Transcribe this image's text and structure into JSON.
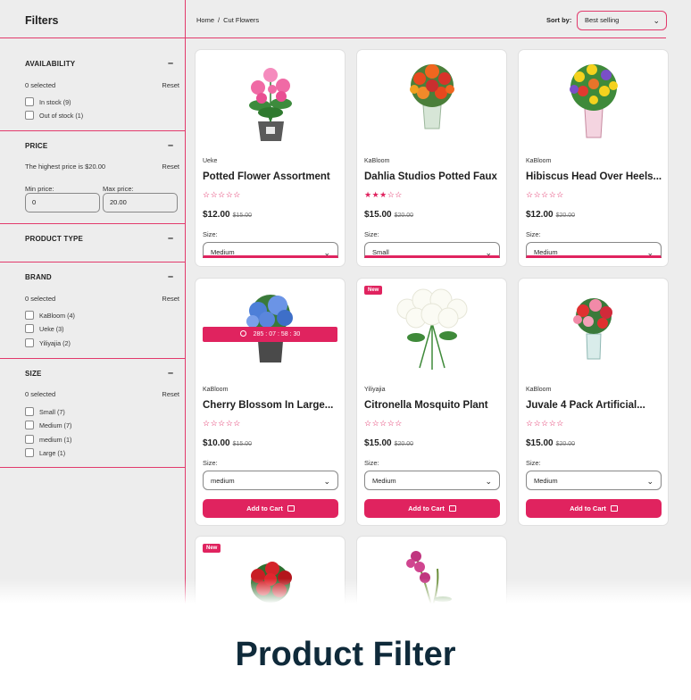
{
  "sidebar": {
    "title": "Filters",
    "availability": {
      "heading": "AVAILABILITY",
      "selected": "0 selected",
      "reset": "Reset",
      "options": [
        {
          "label": "In stock (9)"
        },
        {
          "label": "Out of stock (1)"
        }
      ]
    },
    "price": {
      "heading": "PRICE",
      "note": "The highest price is $20.00",
      "reset": "Reset",
      "min_label": "Min price:",
      "max_label": "Max price:",
      "min_value": "0",
      "max_value": "20.00"
    },
    "product_type": {
      "heading": "PRODUCT TYPE"
    },
    "brand": {
      "heading": "BRAND",
      "selected": "0 selected",
      "reset": "Reset",
      "options": [
        {
          "label": "KaBloom (4)"
        },
        {
          "label": "Ueke (3)"
        },
        {
          "label": "Yiliyajia (2)"
        }
      ]
    },
    "size": {
      "heading": "SIZE",
      "selected": "0 selected",
      "reset": "Reset",
      "options": [
        {
          "label": "Small (7)"
        },
        {
          "label": "Medium (7)"
        },
        {
          "label": "medium (1)"
        },
        {
          "label": "Large (1)"
        }
      ]
    }
  },
  "toolbar": {
    "breadcrumb": [
      "Home",
      "/",
      "Cut Flowers"
    ],
    "sort_label": "Sort by:",
    "sort_value": "Best selling"
  },
  "products": [
    {
      "vendor": "Ueke",
      "title": "Potted Flower Assortment",
      "stars": "☆☆☆☆☆",
      "price": "$12.00",
      "old_price": "$15.00",
      "size_label": "Size:",
      "size_value": "Medium"
    },
    {
      "vendor": "KaBloom",
      "title": "Dahlia Studios Potted Faux",
      "stars": "★★★☆☆",
      "price": "$15.00",
      "old_price": "$20.00",
      "size_label": "Size:",
      "size_value": "Small"
    },
    {
      "vendor": "KaBloom",
      "title": "Hibiscus Head Over Heels...",
      "stars": "☆☆☆☆☆",
      "price": "$12.00",
      "old_price": "$20.00",
      "size_label": "Size:",
      "size_value": "Medium"
    },
    {
      "vendor": "KaBloom",
      "title": "Cherry Blossom In Large...",
      "stars": "☆☆☆☆☆",
      "price": "$10.00",
      "old_price": "$15.00",
      "size_label": "Size:",
      "size_value": "medium",
      "button": "Add to Cart",
      "timer": [
        "285",
        ":",
        "07",
        ":",
        "58",
        ":",
        "30"
      ]
    },
    {
      "vendor": "Yiliyajia",
      "title": "Citronella Mosquito Plant",
      "stars": "☆☆☆☆☆",
      "price": "$15.00",
      "old_price": "$20.00",
      "size_label": "Size:",
      "size_value": "Medium",
      "button": "Add to Cart",
      "badge": "New"
    },
    {
      "vendor": "KaBloom",
      "title": "Juvale 4 Pack Artificial...",
      "stars": "☆☆☆☆☆",
      "price": "$15.00",
      "old_price": "$20.00",
      "size_label": "Size:",
      "size_value": "Medium",
      "button": "Add to Cart"
    },
    {
      "badge": "New"
    }
  ],
  "banner": {
    "title": "Product Filter"
  },
  "colors": {
    "accent": "#e0235f",
    "divider": "#e23a6c",
    "banner_text": "#0f2a3a"
  }
}
